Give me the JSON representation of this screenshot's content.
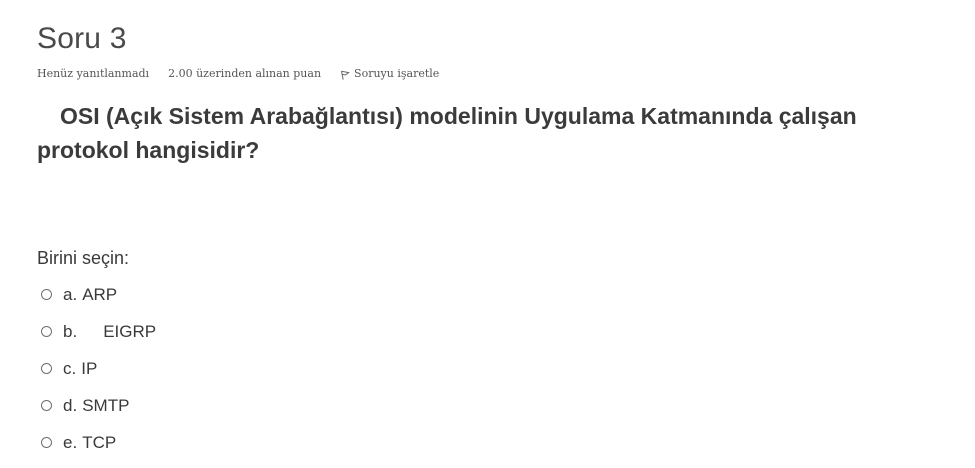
{
  "question": {
    "title": "Soru 3",
    "state": "Henüz yanıtlanmadı",
    "grade": "2.00 üzerinden alınan puan",
    "flag_label": "Soruyu işaretle",
    "text": "OSI (Açık Sistem Arabağlantısı) modelinin Uygulama Katmanında çalışan protokol hangisidir?",
    "prompt": "Birini seçin:"
  },
  "answers": [
    {
      "number": "a.",
      "text": "ARP"
    },
    {
      "number": "b.",
      "text": "EIGRP"
    },
    {
      "number": "c.",
      "text": "IP"
    },
    {
      "number": "d.",
      "text": "SMTP"
    },
    {
      "number": "e.",
      "text": "TCP"
    }
  ],
  "icons": {
    "flag": "flag-icon"
  }
}
